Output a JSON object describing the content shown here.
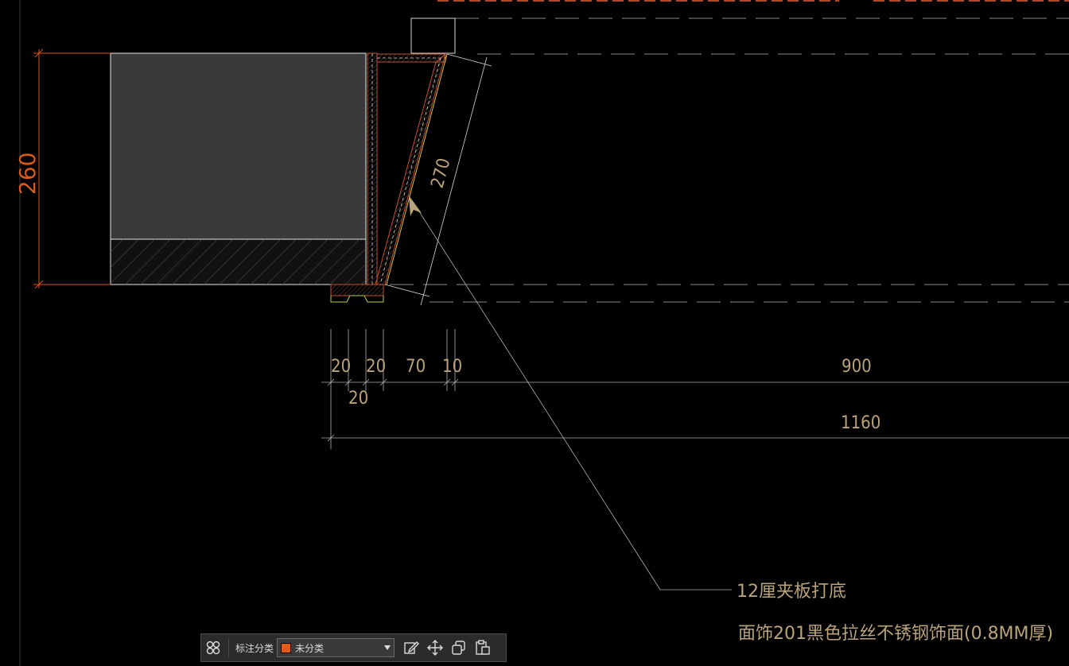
{
  "colors": {
    "background": "#000000",
    "dimension_red": "#d45a1e",
    "dimension_text": "#b9a37a",
    "category_swatch": "#e05a1a"
  },
  "drawing": {
    "dimensions": {
      "height_260": "260",
      "diagonal_270": "270",
      "seg_20_a": "20",
      "seg_20_b": "20",
      "seg_70": "70",
      "seg_10": "10",
      "seg_20_c": "20",
      "seg_900": "900",
      "seg_1160": "1160"
    },
    "notes": {
      "note_1": "12厘夹板打底",
      "note_2": "面饰201黑色拉丝不锈钢饰面(0.8MM厚)"
    }
  },
  "toolbar": {
    "grid_icon": "grid-icon",
    "category_label": "标注分类",
    "category_value": "未分类",
    "edit_icon": "edit-icon",
    "move_icon": "move-icon",
    "copy_icon": "copy-icon",
    "paste_icon": "paste-icon"
  }
}
